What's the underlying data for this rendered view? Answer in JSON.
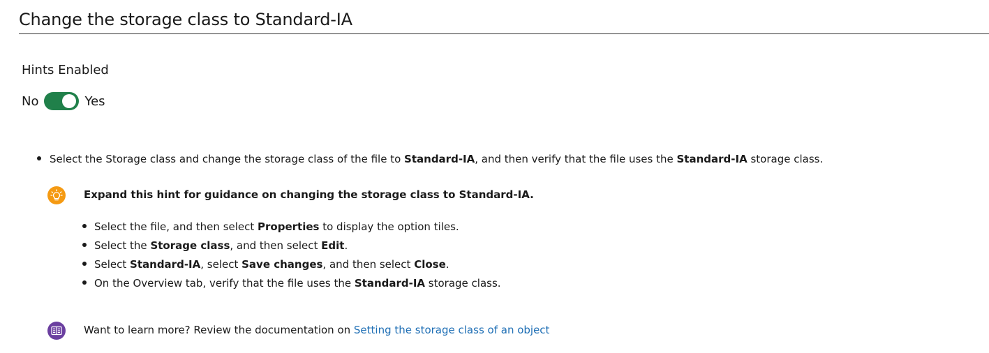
{
  "header": {
    "title": "Change the storage class to Standard-IA"
  },
  "hints": {
    "label": "Hints Enabled",
    "toggle": {
      "off_label": "No",
      "on_label": "Yes",
      "state": "on",
      "color": "#20804a"
    }
  },
  "task": {
    "part1": "Select the Storage class and change the storage class of the file to ",
    "bold1": "Standard-IA",
    "part2": ", and then verify that the file uses the ",
    "bold2": "Standard-IA",
    "part3": " storage class."
  },
  "hint": {
    "icon": "lightbulb-icon",
    "icon_color": "#f59a12",
    "summary": "Expand this hint for guidance on changing the storage class to Standard-IA.",
    "steps": [
      {
        "t1": "Select the file, and then select ",
        "b1": "Properties",
        "t2": " to display the option tiles."
      },
      {
        "t1": "Select the ",
        "b1": "Storage class",
        "t2": ", and then select ",
        "b2": "Edit",
        "t3": "."
      },
      {
        "t1": "Select ",
        "b1": "Standard-IA",
        "t2": ", select ",
        "b2": "Save changes",
        "t3": ", and then select ",
        "b3": "Close",
        "t4": "."
      },
      {
        "t1": "On the Overview tab, verify that the file uses the ",
        "b1": "Standard-IA",
        "t2": " storage class."
      }
    ]
  },
  "learn_more": {
    "icon": "book-icon",
    "icon_color": "#6b3fa0",
    "text": "Want to learn more? Review the documentation on ",
    "link_text": "Setting the storage class of an object",
    "link_color": "#1f6fb5"
  }
}
